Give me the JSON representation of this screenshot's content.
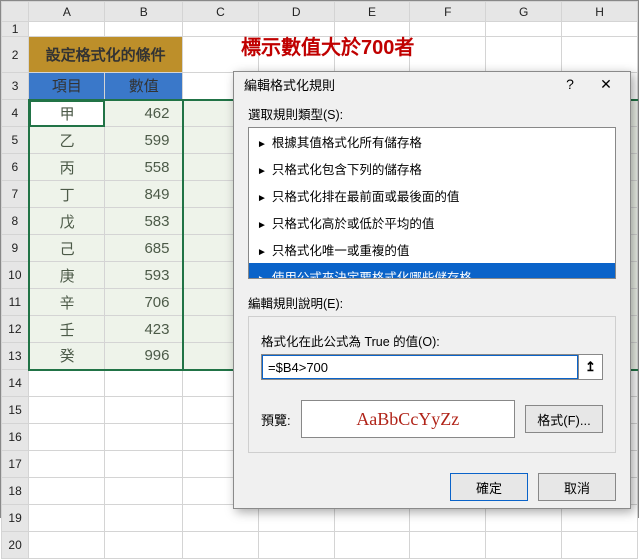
{
  "columns": [
    "A",
    "B",
    "C",
    "D",
    "E",
    "F",
    "G",
    "H"
  ],
  "rows_count": 20,
  "title_cell": "設定格式化的條件",
  "header_row": {
    "item": "項目",
    "value": "數值"
  },
  "data_rows": [
    {
      "item": "甲",
      "value": 462,
      "highlight": false
    },
    {
      "item": "乙",
      "value": 599,
      "highlight": false
    },
    {
      "item": "丙",
      "value": 558,
      "highlight": false
    },
    {
      "item": "丁",
      "value": 849,
      "highlight": true
    },
    {
      "item": "戊",
      "value": 583,
      "highlight": false
    },
    {
      "item": "己",
      "value": 685,
      "highlight": false
    },
    {
      "item": "庚",
      "value": 593,
      "highlight": false
    },
    {
      "item": "辛",
      "value": 706,
      "highlight": true
    },
    {
      "item": "壬",
      "value": 423,
      "highlight": false
    },
    {
      "item": "癸",
      "value": 996,
      "highlight": true
    }
  ],
  "red_heading": "標示數值大於700者",
  "dialog": {
    "title": "編輯格式化規則",
    "help": "?",
    "close": "✕",
    "select_rule_type_label": "選取規則類型(S):",
    "rule_types": [
      "根據其值格式化所有儲存格",
      "只格式化包含下列的儲存格",
      "只格式化排在最前面或最後面的值",
      "只格式化高於或低於平均的值",
      "只格式化唯一或重複的值",
      "使用公式來決定要格式化哪些儲存格"
    ],
    "selected_rule_index": 5,
    "edit_rule_desc_label": "編輯規則說明(E):",
    "formula_label": "格式化在此公式為 True 的值(O):",
    "formula_value": "=$B4>700",
    "preview_label": "預覽:",
    "preview_sample": "AaBbCcYyZz",
    "format_button": "格式(F)...",
    "ok_button": "確定",
    "cancel_button": "取消"
  }
}
